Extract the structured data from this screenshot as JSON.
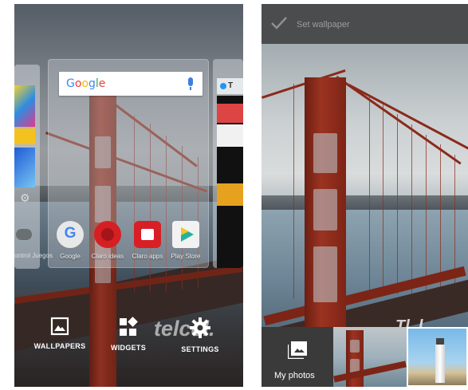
{
  "home_overview": {
    "search_widget": {
      "logo_text": "Google"
    },
    "partial_app_label": "ontrol Juegos",
    "apps": [
      {
        "label": "Google"
      },
      {
        "label": "Claro ideas"
      },
      {
        "label": "Claro apps"
      },
      {
        "label": "Play Store"
      }
    ],
    "right_preview_title": "T",
    "watermark_text": "telcel.",
    "actions": {
      "wallpapers": "WALLPAPERS",
      "widgets": "WIDGETS",
      "settings": "SETTINGS"
    }
  },
  "wallpaper_picker": {
    "header_label": "Set wallpaper",
    "tray": {
      "my_photos_label": "My photos"
    },
    "overlay_text": "Tl..l"
  },
  "colors": {
    "accent_bridge_red": "#9c3321",
    "topbar": "#4a4c4e",
    "tray": "#3a3a3a"
  },
  "icons": [
    "wallpaper-icon",
    "widgets-icon",
    "settings-icon",
    "check-icon",
    "photos-icon",
    "mic-icon"
  ]
}
